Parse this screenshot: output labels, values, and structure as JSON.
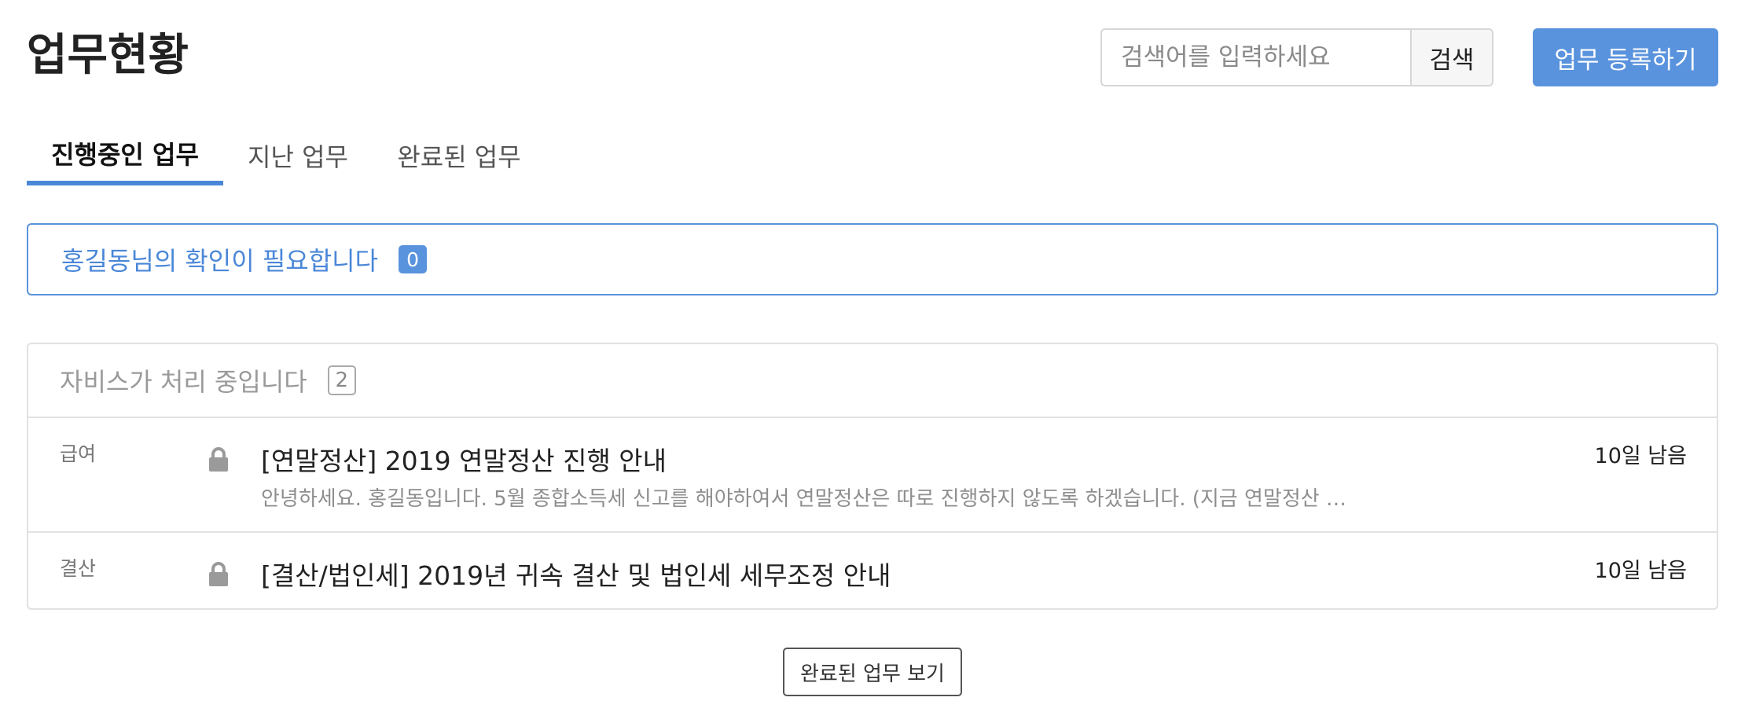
{
  "header": {
    "title": "업무현황",
    "search": {
      "placeholder": "검색어를 입력하세요",
      "value": "",
      "button_label": "검색"
    },
    "register_label": "업무 등록하기"
  },
  "tabs": [
    {
      "label": "진행중인 업무",
      "active": true
    },
    {
      "label": "지난 업무",
      "active": false
    },
    {
      "label": "완료된 업무",
      "active": false
    }
  ],
  "notice": {
    "text": "홍길동님의 확인이 필요합니다",
    "count": "0"
  },
  "panel": {
    "title": "자비스가 처리 중입니다",
    "count": "2",
    "tasks": [
      {
        "category": "급여",
        "icon": "lock-icon",
        "title": "[연말정산] 2019 연말정산 진행 안내",
        "description": "안녕하세요. 홍길동입니다. 5월 종합소득세 신고를 해야하여서 연말정산은 따로 진행하지 않도록 하겠습니다. (지금 연말정산 …",
        "deadline": "10일 남음"
      },
      {
        "category": "결산",
        "icon": "lock-icon",
        "title": "[결산/법인세] 2019년 귀속 결산 및 법인세 세무조정 안내",
        "description": "",
        "deadline": "10일 남음"
      }
    ]
  },
  "footer": {
    "completed_button_label": "완료된 업무 보기"
  },
  "colors": {
    "accent": "#5a93dd",
    "accent_text": "#4a87d8",
    "border": "#e2e2e2",
    "muted_text": "#9a9a9a"
  }
}
